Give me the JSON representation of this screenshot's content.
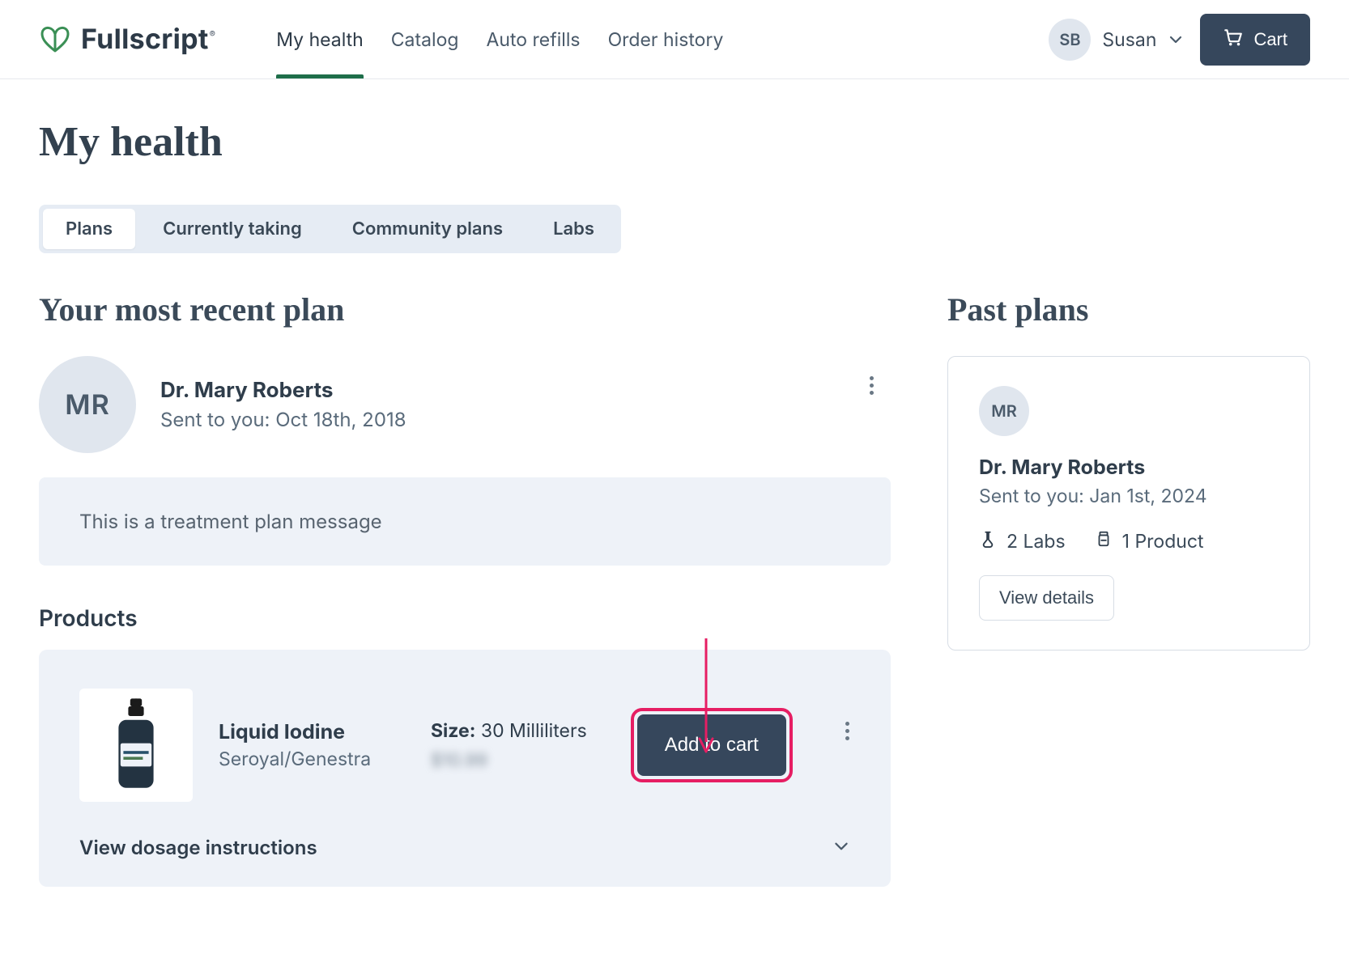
{
  "brand": {
    "name": "Fullscript"
  },
  "nav": {
    "items": [
      {
        "label": "My health",
        "active": true
      },
      {
        "label": "Catalog",
        "active": false
      },
      {
        "label": "Auto refills",
        "active": false
      },
      {
        "label": "Order history",
        "active": false
      }
    ]
  },
  "user": {
    "initials": "SB",
    "name": "Susan"
  },
  "cart": {
    "label": "Cart"
  },
  "page": {
    "title": "My health"
  },
  "tabs": [
    {
      "label": "Plans",
      "active": true
    },
    {
      "label": "Currently taking",
      "active": false
    },
    {
      "label": "Community plans",
      "active": false
    },
    {
      "label": "Labs",
      "active": false
    }
  ],
  "recent": {
    "heading": "Your most recent plan",
    "provider_initials": "MR",
    "provider_name": "Dr. Mary Roberts",
    "sent_label": "Sent to you: Oct 18th, 2018",
    "message": "This is a treatment plan message",
    "products_heading": "Products",
    "product": {
      "name": "Liquid Iodine",
      "brand": "Seroyal/Genestra",
      "size_label": "Size:",
      "size_value": "30 Milliliters",
      "price_blurred": "$10.99",
      "add_to_cart": "Add to cart",
      "dosage_label": "View dosage instructions"
    }
  },
  "past": {
    "heading": "Past plans",
    "provider_initials": "MR",
    "provider_name": "Dr. Mary Roberts",
    "sent_label": "Sent to you: Jan 1st, 2024",
    "labs_count": "2 Labs",
    "products_count": "1 Product",
    "view_details": "View details"
  },
  "colors": {
    "navy": "#36475c",
    "green": "#2e8b57",
    "card_bg": "#eef2f8",
    "highlight": "#e61e63"
  }
}
